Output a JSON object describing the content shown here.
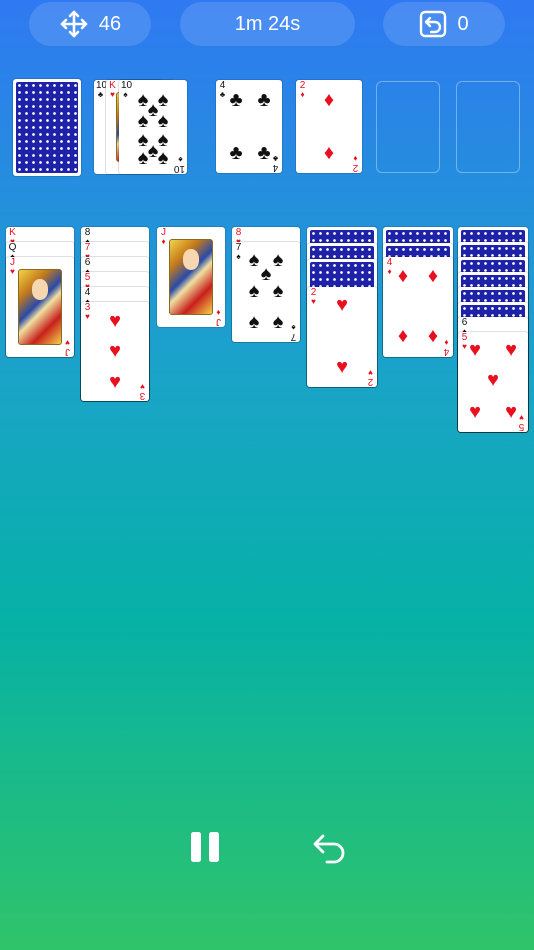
{
  "status": {
    "moves": "46",
    "timer": "1m 24s",
    "undos": "0"
  },
  "icons": {
    "moves": "move-arrows-icon",
    "undo_counter": "undo-box-icon",
    "pause": "pause-icon",
    "undo": "undo-arrow-icon"
  },
  "colors": {
    "red_suit": "#e8101f",
    "black_suit": "#111111",
    "card_back": "#1e22a8"
  },
  "waste": {
    "card1": {
      "rank": "10",
      "suit": "♣"
    },
    "card2": {
      "rank": "K",
      "suit": "♥"
    },
    "top": {
      "rank": "10",
      "suit": "♠"
    }
  },
  "foundations": {
    "clubs": {
      "rank": "4",
      "suit": "♣"
    },
    "diamonds": {
      "rank": "2",
      "suit": "♦"
    }
  },
  "tableau": {
    "col1": {
      "c1": {
        "rank": "K",
        "suit": "♥"
      },
      "c2": {
        "rank": "Q",
        "suit": "♠"
      },
      "top": {
        "rank": "J",
        "suit": "♥"
      }
    },
    "col2": {
      "c1": {
        "rank": "8",
        "suit": "♠"
      },
      "c2": {
        "rank": "7",
        "suit": "♥"
      },
      "c3": {
        "rank": "6",
        "suit": "♠"
      },
      "c4": {
        "rank": "5",
        "suit": "♥"
      },
      "c5": {
        "rank": "4",
        "suit": "♠"
      },
      "top": {
        "rank": "3",
        "suit": "♥"
      }
    },
    "col3": {
      "top": {
        "rank": "J",
        "suit": "♦"
      }
    },
    "col4": {
      "c1": {
        "rank": "8",
        "suit": "♥"
      },
      "top": {
        "rank": "7",
        "suit": "♠"
      }
    },
    "col5": {
      "top": {
        "rank": "2",
        "suit": "♥"
      }
    },
    "col6": {
      "top": {
        "rank": "4",
        "suit": "♦"
      }
    },
    "col7": {
      "c1": {
        "rank": "6",
        "suit": "♠"
      },
      "top": {
        "rank": "5",
        "suit": "♥"
      }
    }
  }
}
